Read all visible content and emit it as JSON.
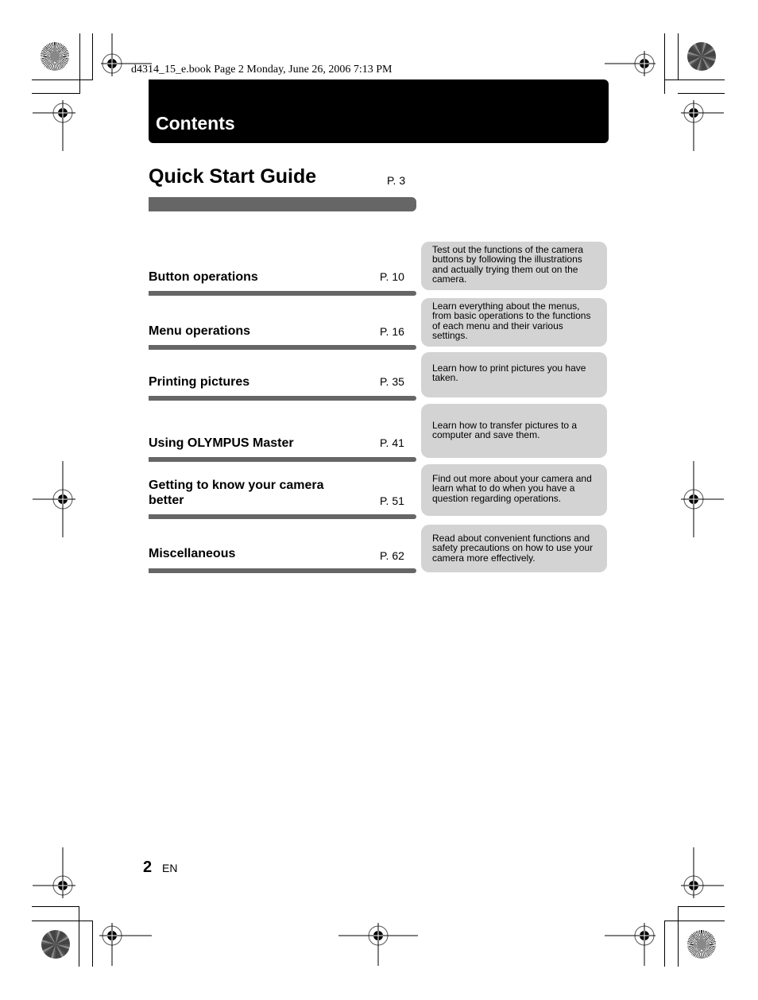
{
  "header": {
    "book_info": "d4314_15_e.book  Page 2  Monday, June 26, 2006  7:13 PM"
  },
  "banner": {
    "title": "Contents"
  },
  "quick_start": {
    "title": "Quick Start Guide",
    "page": "P. 3"
  },
  "toc": [
    {
      "title": "Button operations",
      "page": "P. 10",
      "description": "Test out the functions of the camera buttons by following the illustrations and actually trying them out on the camera."
    },
    {
      "title": "Menu operations",
      "page": "P. 16",
      "description": "Learn everything about the menus, from basic operations to the functions of each menu and their various settings."
    },
    {
      "title": "Printing pictures",
      "page": "P. 35",
      "description": "Learn how to print pictures you have taken."
    },
    {
      "title": "Using OLYMPUS Master",
      "page": "P. 41",
      "description": "Learn how to transfer pictures to a computer and save them."
    },
    {
      "title": "Getting to know your camera better",
      "page": "P. 51",
      "description": "Find out more about your camera and learn what to do when you have a question regarding operations."
    },
    {
      "title": "Miscellaneous",
      "page": "P. 62",
      "description": "Read about convenient functions and safety precautions on how to use your camera more effectively."
    }
  ],
  "footer": {
    "page_number": "2",
    "language": "EN"
  },
  "colors": {
    "banner": "#000000",
    "bar": "#666666",
    "description_box": "#d3d3d3"
  },
  "icons": {
    "registration_mark": "registration-mark-icon",
    "color_target": "print-target-icon"
  }
}
